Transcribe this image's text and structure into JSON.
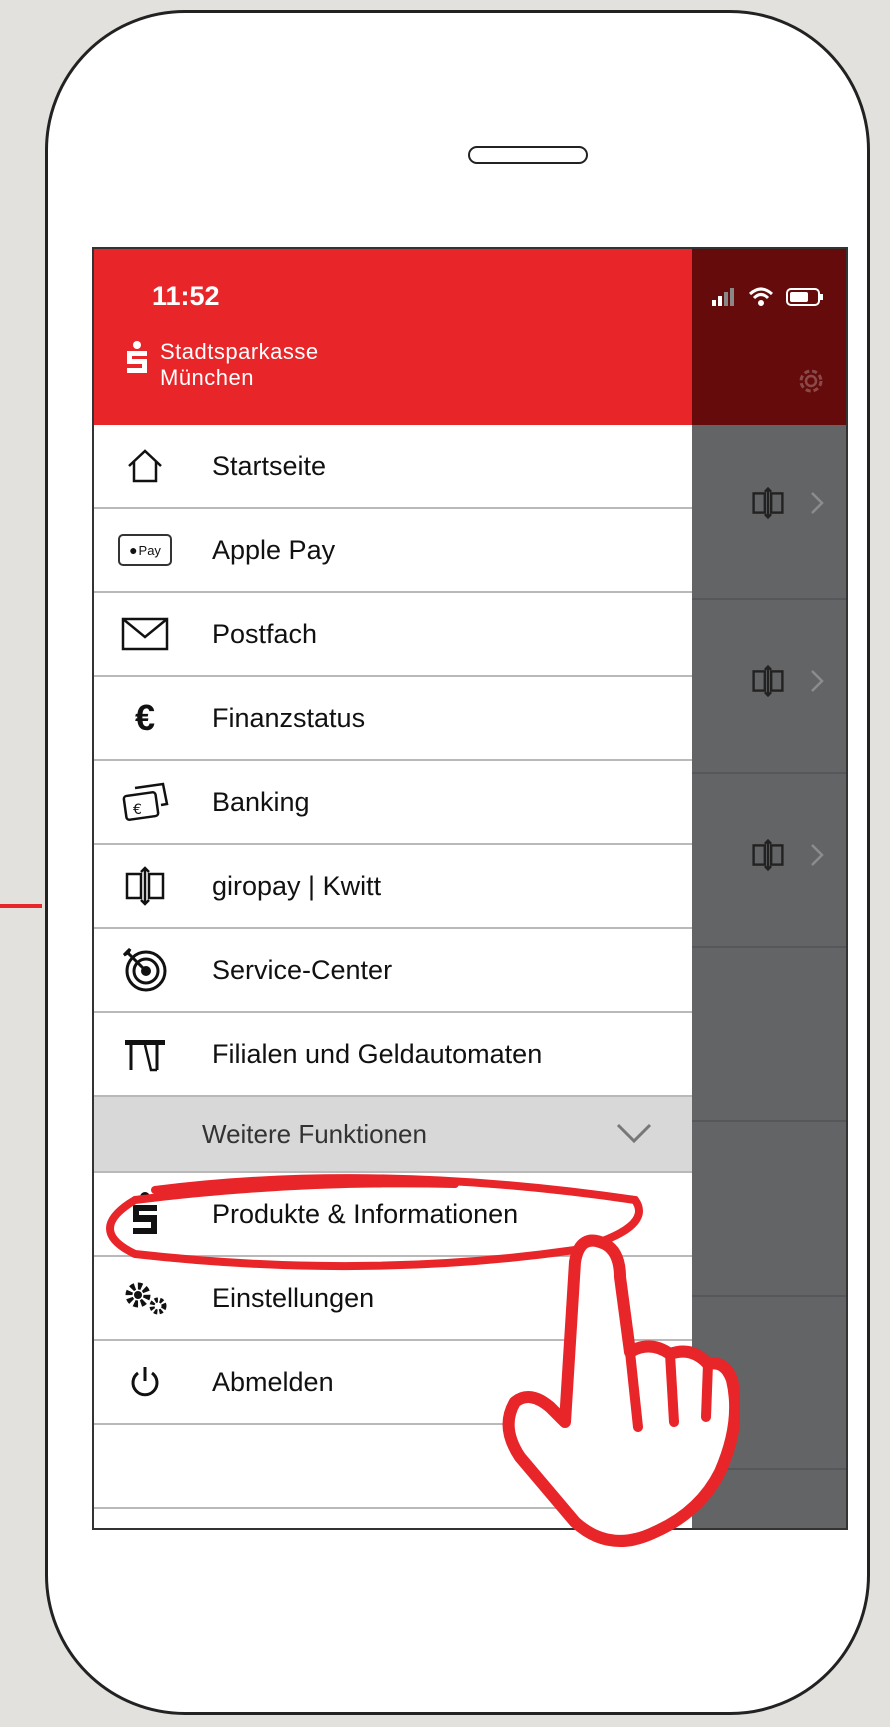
{
  "status_bar": {
    "time": "11:52"
  },
  "brand": {
    "line1": "Stadtsparkasse",
    "line2": "München"
  },
  "menu": {
    "items": [
      {
        "label": "Startseite",
        "icon": "home-icon"
      },
      {
        "label": "Apple Pay",
        "icon": "apple-pay-icon",
        "icon_text": "Pay"
      },
      {
        "label": "Postfach",
        "icon": "mail-icon"
      },
      {
        "label": "Finanzstatus",
        "icon": "euro-icon",
        "icon_text": "€"
      },
      {
        "label": "Banking",
        "icon": "banking-cards-icon"
      },
      {
        "label": "giropay | Kwitt",
        "icon": "giropay-transfer-icon"
      },
      {
        "label": "Service-Center",
        "icon": "target-icon"
      },
      {
        "label": "Filialen und Geldautomaten",
        "icon": "atm-icon"
      }
    ],
    "section": {
      "label": "Weitere Funktionen",
      "icon": "chevron-down-icon"
    },
    "more_items": [
      {
        "label": "Produkte & Informationen",
        "icon": "sparkasse-logo-icon"
      },
      {
        "label": "Einstellungen",
        "icon": "gears-icon"
      },
      {
        "label": "Abmelden",
        "icon": "power-icon"
      }
    ]
  },
  "colors": {
    "brand_red": "#e8262a",
    "header_dark": "#650b0b",
    "overlay_gray": "#626466",
    "section_gray": "#d8d8d8",
    "annotation_red": "#e8262a"
  }
}
